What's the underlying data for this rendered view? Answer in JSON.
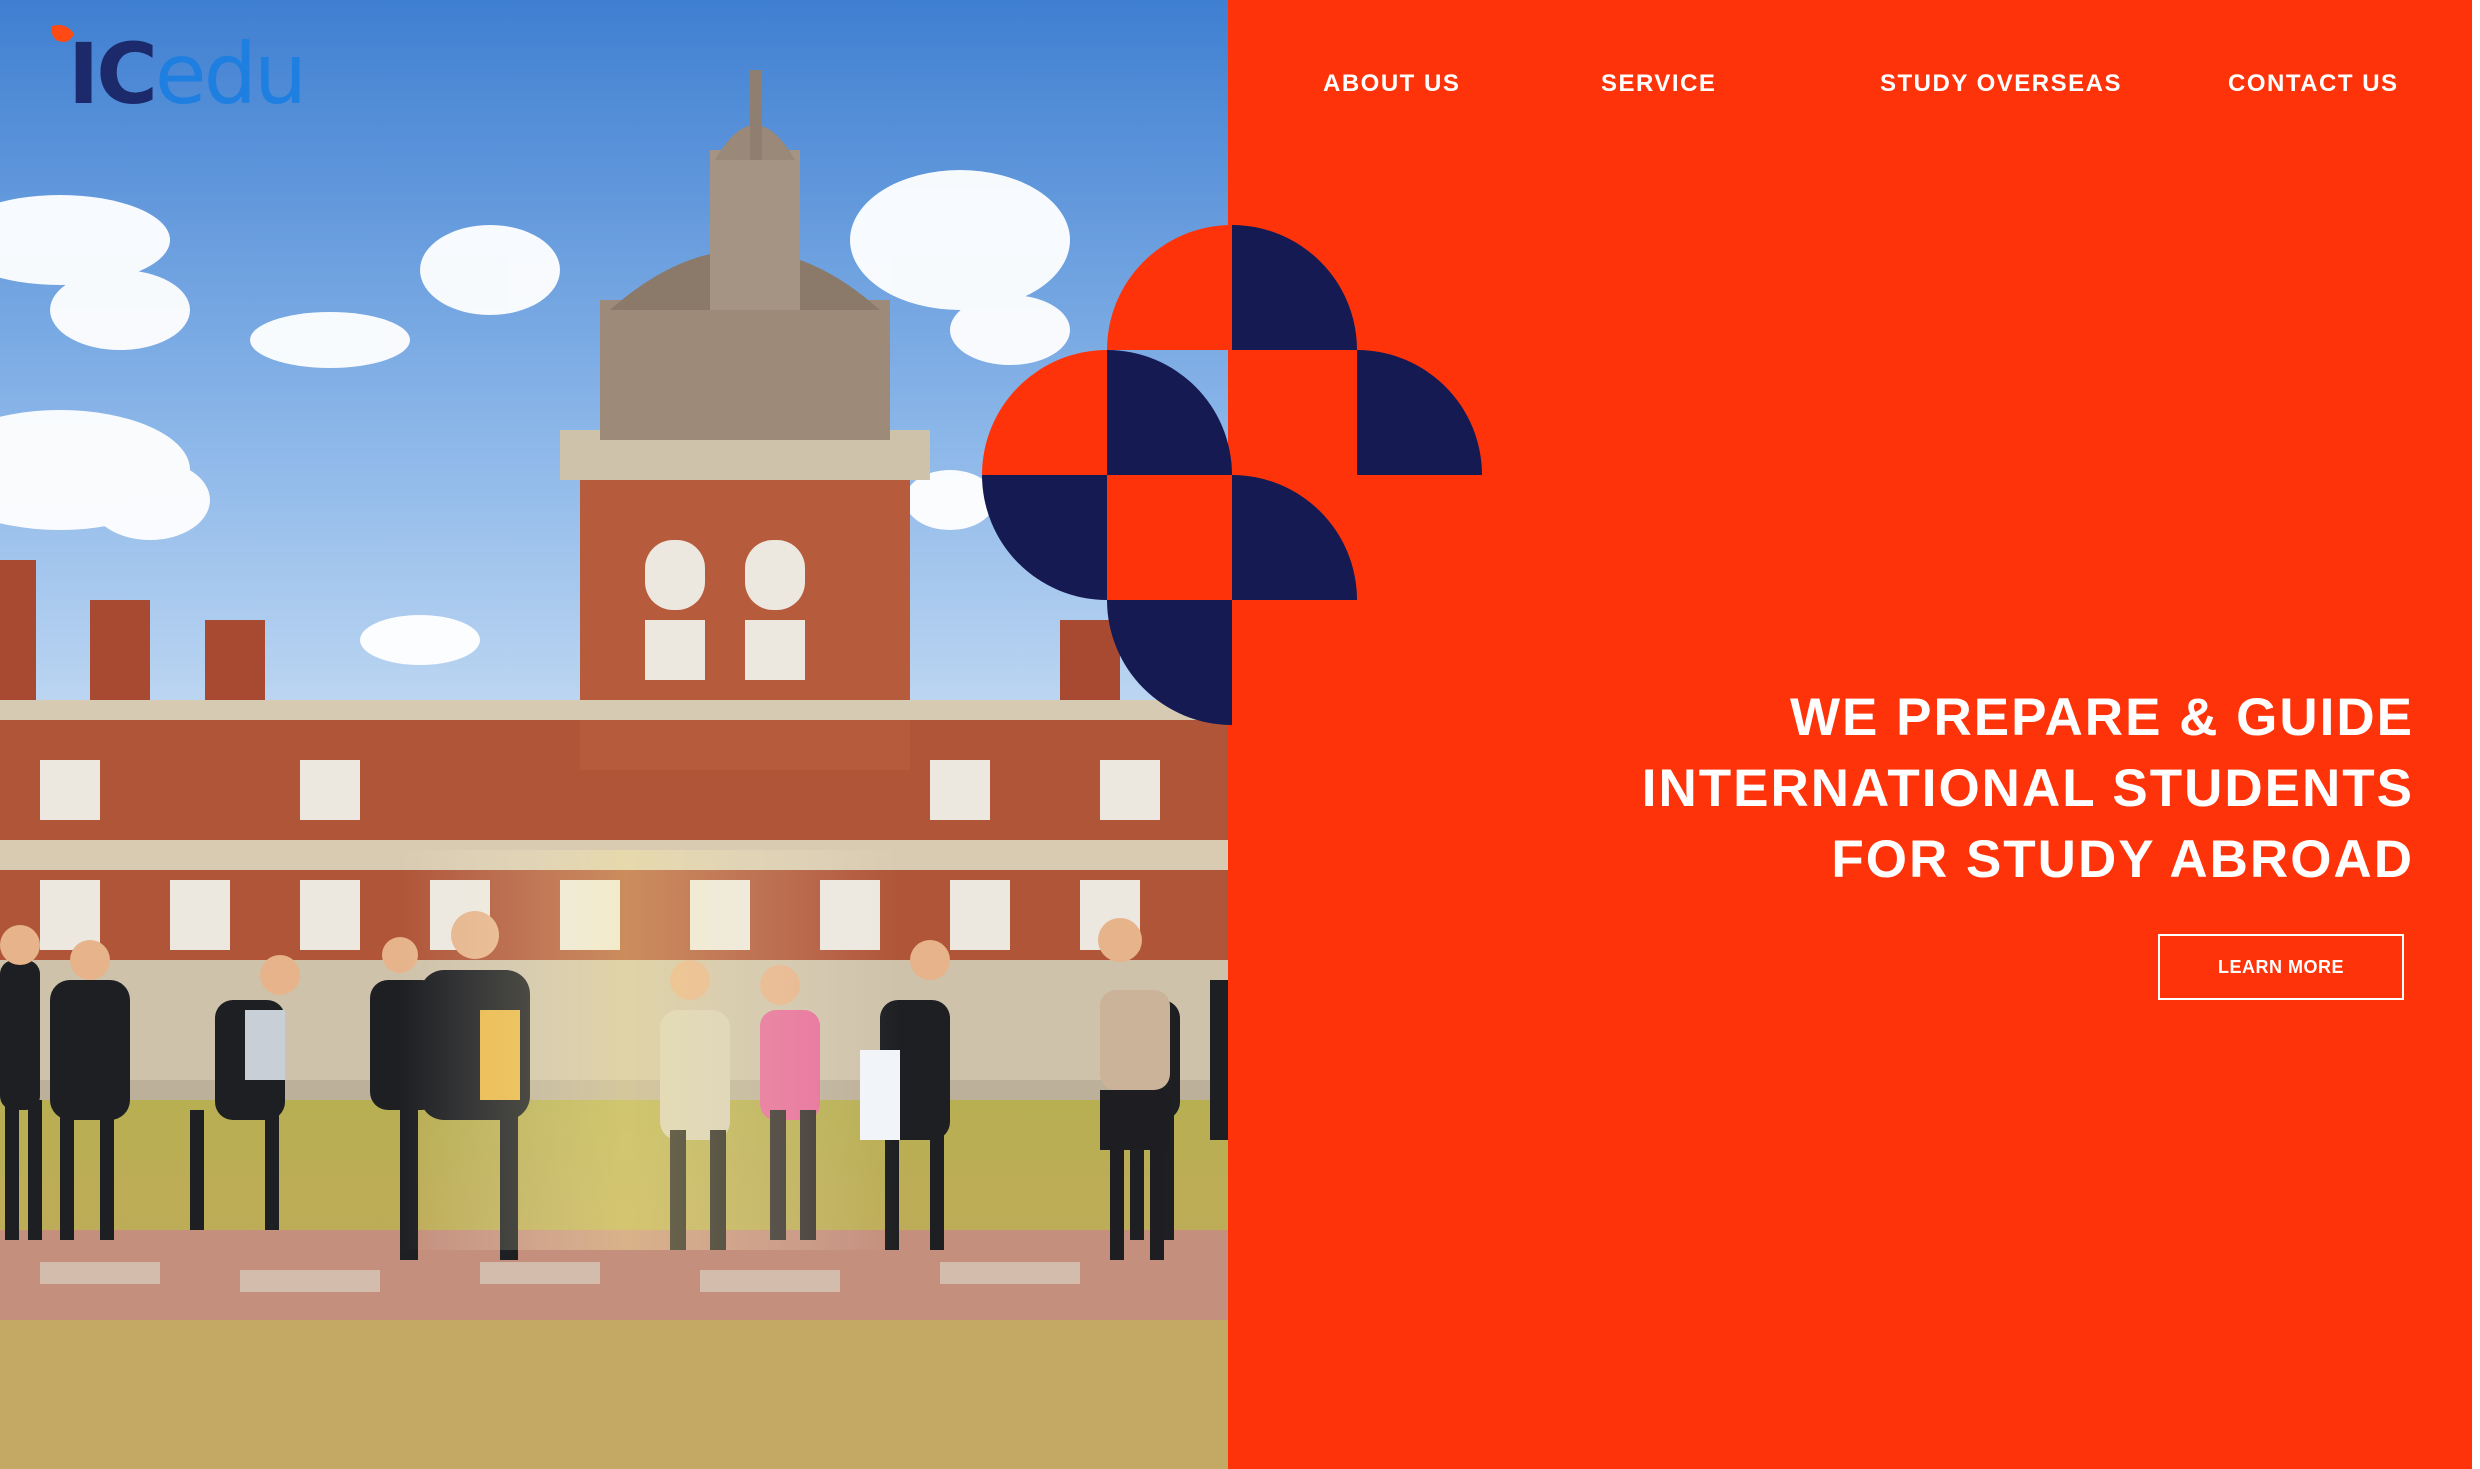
{
  "logo": {
    "part1": "IC",
    "part2": "edu",
    "leaf_color": "#ff4a14",
    "ic_color": "#1c2a6b",
    "edu_color": "#1e7fe0"
  },
  "nav": {
    "items": [
      {
        "label": "ABOUT US"
      },
      {
        "label": "SERVICE"
      },
      {
        "label": "STUDY OVERSEAS"
      },
      {
        "label": "CONTACT US"
      }
    ]
  },
  "hero": {
    "headline_lines": [
      "WE PREPARE & GUIDE",
      "INTERNATIONAL STUDENTS",
      "FOR STUDY ABROAD"
    ],
    "cta_label": "LEARN MORE"
  },
  "colors": {
    "accent": "#ff330a",
    "navy": "#151a52",
    "white": "#ffffff"
  },
  "image": {
    "description_icon": "campus-photo"
  }
}
